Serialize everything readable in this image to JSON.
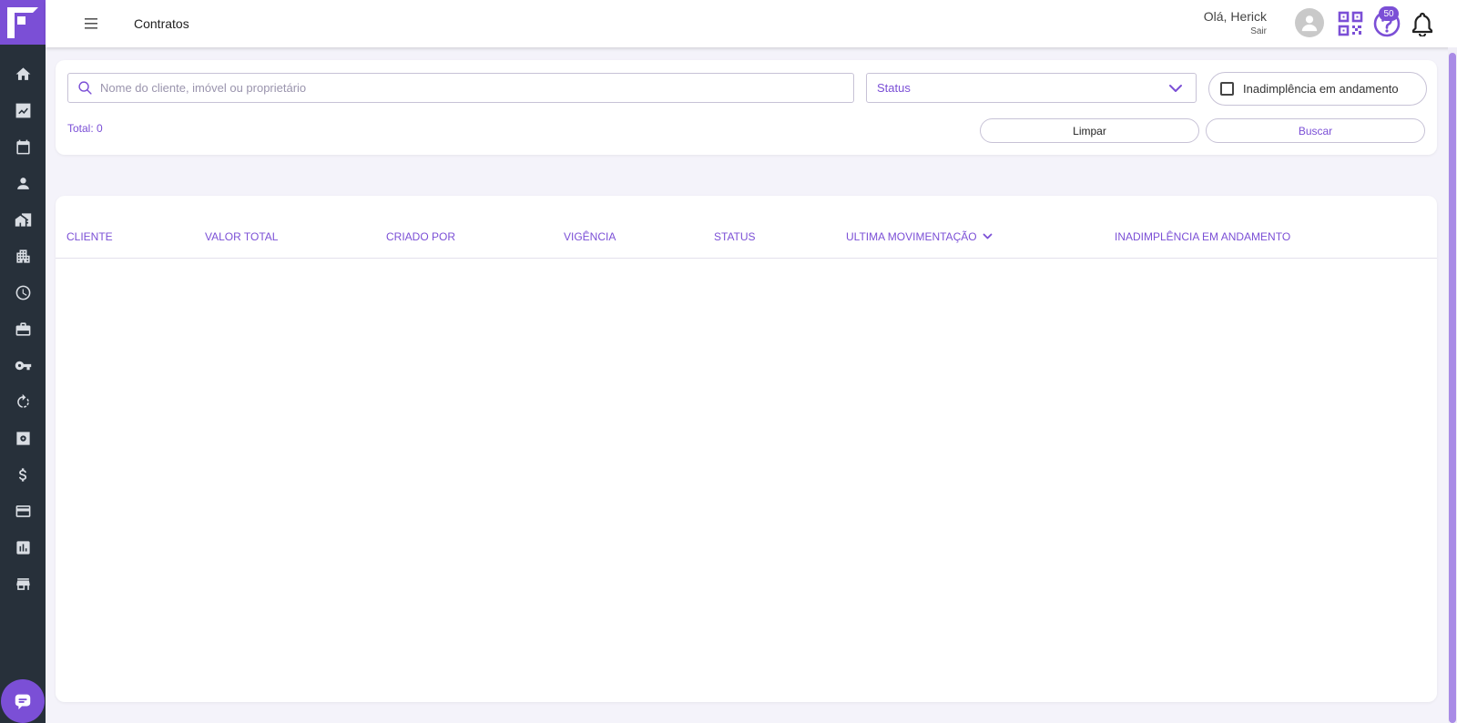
{
  "header": {
    "title": "Contratos",
    "greeting": "Olá, Herick",
    "logout": "Sair",
    "notifications_count": "50"
  },
  "sidebar": {
    "items": [
      {
        "icon": "home-icon"
      },
      {
        "icon": "trending-icon"
      },
      {
        "icon": "calendar-icon"
      },
      {
        "icon": "person-icon"
      },
      {
        "icon": "building-icon"
      },
      {
        "icon": "apartment-icon"
      },
      {
        "icon": "clock-icon"
      },
      {
        "icon": "briefcase-icon"
      },
      {
        "icon": "key-icon"
      },
      {
        "icon": "rotate-icon"
      },
      {
        "icon": "safe-icon"
      },
      {
        "icon": "dollar-icon"
      },
      {
        "icon": "credit-card-icon"
      },
      {
        "icon": "bar-chart-icon"
      },
      {
        "icon": "store-icon"
      }
    ]
  },
  "filters": {
    "search_placeholder": "Nome do cliente, imóvel ou proprietário",
    "status_placeholder": "Status",
    "delinquency_checkbox_label": "Inadimplência em andamento",
    "total_label": "Total: 0",
    "clear_label": "Limpar",
    "search_label": "Buscar"
  },
  "table": {
    "columns": [
      "CLIENTE",
      "VALOR TOTAL",
      "CRIADO POR",
      "VIGÊNCIA",
      "STATUS",
      "ULTIMA MOVIMENTAÇÃO",
      "INADIMPLÊNCIA EM ANDAMENTO"
    ],
    "rows": []
  },
  "colors": {
    "accent": "#7b4fd6",
    "sidebar_bg": "#27303a",
    "page_bg": "#f4f3fa"
  }
}
